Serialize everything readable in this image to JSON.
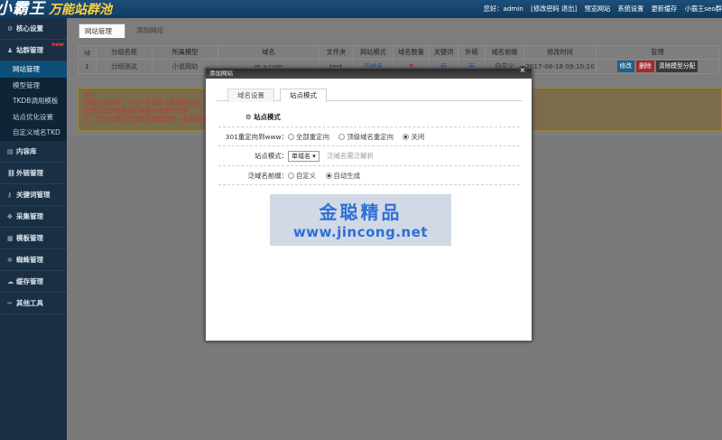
{
  "header": {
    "logo_main": "小霸王",
    "logo_sub": "万能站群池",
    "greeting": "您好：admin",
    "links": [
      "[修改密码 退出]",
      "预览网站",
      "系统设置",
      "更新缓存",
      "小霸王seo群"
    ]
  },
  "sidebar": {
    "groups": [
      {
        "label": "核心设置",
        "icon": "gear-icon",
        "glyph": "⚙"
      },
      {
        "label": "站群管理",
        "icon": "user-icon",
        "glyph": "♟",
        "badge": "new",
        "items": [
          "网站管理",
          "模型管理",
          "TKDB调用模板",
          "站点优化设置",
          "自定义域名TKD"
        ]
      },
      {
        "label": "内容库",
        "icon": "book-icon",
        "glyph": "▤"
      },
      {
        "label": "外链管理",
        "icon": "link-icon",
        "glyph": "⛓"
      },
      {
        "label": "关键词管理",
        "icon": "key-icon",
        "glyph": "⚷"
      },
      {
        "label": "采集管理",
        "icon": "crosshair-icon",
        "glyph": "✥"
      },
      {
        "label": "模板管理",
        "icon": "template-icon",
        "glyph": "▦"
      },
      {
        "label": "蜘蛛管理",
        "icon": "spider-icon",
        "glyph": "✲"
      },
      {
        "label": "缓存管理",
        "icon": "cache-icon",
        "glyph": "☁"
      },
      {
        "label": "其他工具",
        "icon": "tools-icon",
        "glyph": "✂"
      }
    ],
    "active_item": "网站管理"
  },
  "main": {
    "tabs": [
      "网站管理",
      "添加网站"
    ],
    "table": {
      "headers": [
        "id",
        "分组名称",
        "所属模型",
        "域名",
        "文件夹",
        "网站模式",
        "域名数量",
        "关键词",
        "外链",
        "域名前缀",
        "修改时间",
        "管理"
      ],
      "rows": [
        {
          "id": "1",
          "group": "分组测试",
          "model": "小说网站",
          "domain": "m.a.com",
          "folder": "test",
          "mode": "泛域名",
          "count": "2",
          "keyword": "有",
          "link": "有",
          "prefix": "自定义",
          "time": "2017-08-18 09:10:10"
        }
      ],
      "actions": [
        "修改",
        "删除",
        "清除模型分配"
      ]
    },
    "tips": {
      "title": "提示：",
      "lines": [
        "网站分组管理，可以个性化每个网站的风格。",
        "关键词和外链是基于网站分组进行管理",
        "注：已经设置过的域名更换模型的，需要清除"
      ]
    }
  },
  "modal": {
    "title": "添加网站",
    "close": "×",
    "tabs": [
      "域名设置",
      "站点模式"
    ],
    "section_title": "站点模式",
    "section_icon": "gear-icon",
    "rows": [
      {
        "label": "301重定向到www：",
        "options": [
          "全部重定向",
          "顶级域名重定向",
          "关闭"
        ],
        "selected": 2
      },
      {
        "label": "站点模式：",
        "select_value": "单域名",
        "help": "泛域名需泛解析"
      },
      {
        "label": "泛域名前缀：",
        "options": [
          "自定义",
          "自动生成"
        ],
        "selected": 1
      }
    ]
  },
  "watermark": {
    "line1": "金聪精品",
    "line2": "www.jincong.net"
  }
}
